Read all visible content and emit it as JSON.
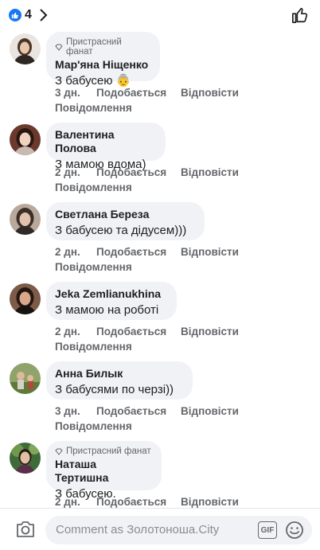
{
  "header": {
    "reaction_count": "4"
  },
  "comments": [
    {
      "badge": "Пристрасний фанат",
      "name": "Мар'яна Ніщенко",
      "text": "З бабусею",
      "emoji": "👵",
      "time": "3 дн.",
      "like": "Подобається",
      "reply": "Відповісти",
      "report": "Повідомлення"
    },
    {
      "badge": "",
      "name": "Валентина Полова",
      "text": "З мамою вдома)",
      "time": "2 дн.",
      "like": "Подобається",
      "reply": "Відповісти",
      "report": "Повідомлення"
    },
    {
      "badge": "",
      "name": "Светлана Береза",
      "text": "З бабусею та дідусем)))",
      "time": "2 дн.",
      "like": "Подобається",
      "reply": "Відповісти",
      "report": "Повідомлення"
    },
    {
      "badge": "",
      "name": "Jeka Zemlianukhina",
      "text": "З мамою на роботі",
      "time": "2 дн.",
      "like": "Подобається",
      "reply": "Відповісти",
      "report": "Повідомлення"
    },
    {
      "badge": "",
      "name": "Анна Билык",
      "text": "З бабусями по черзі))",
      "time": "3 дн.",
      "like": "Подобається",
      "reply": "Відповісти",
      "report": "Повідомлення"
    },
    {
      "badge": "Пристрасний фанат",
      "name": "Наташа Тертишна",
      "text": "З бабусею.",
      "time": "2 дн.",
      "like": "Подобається",
      "reply": "Відповісти",
      "report": ""
    }
  ],
  "composer": {
    "placeholder": "Comment as Золотоноша.City",
    "gif_label": "GIF"
  }
}
